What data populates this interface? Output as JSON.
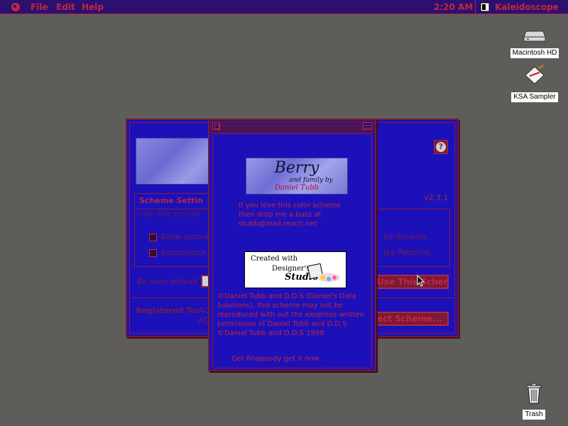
{
  "menubar": {
    "menus": [
      "File",
      "Edit",
      "Help"
    ],
    "clock": "2:20 AM",
    "app_name": "Kaleidoscope"
  },
  "desktop": {
    "icons": [
      {
        "label": "Macintosh HD",
        "icon": "hard-drive-icon"
      },
      {
        "label": "KSA Sampler",
        "icon": "sampler-document-icon"
      },
      {
        "label": "Trash",
        "icon": "trash-icon"
      }
    ]
  },
  "back_window": {
    "tab_label": "Scheme Settin",
    "version": "v2.3.1",
    "group_title": "Use This scheme",
    "options": [
      "Allow auto-s",
      "Automatica",
      "lor Scheme",
      "lay Patterns"
    ],
    "popup_label": "Be uses default",
    "buttons": [
      "Use This Scheme",
      "ect Scheme..."
    ],
    "registered_label": "Registered To:",
    "registered_values": [
      "AC",
      "AC"
    ]
  },
  "about_window": {
    "logo_title": "Berry",
    "logo_subtitle": "and family by",
    "logo_author": "Daniel Tubb",
    "intro": "If you love this color scheme\nthen drop me a buss at\nstubb@mail.reach.net",
    "ds_logo_line1": "Created with",
    "ds_logo_line2": "Designer's",
    "ds_logo_line3": "Studio",
    "copyright": "©Daniel Tubb and D.D.S (Daniel's Data\nSolutions), this scheme may not be\nreproduced with out the exopress written\npermission of Daniel Tubb and D.D.S\n©Daniel Tubb and D.D.S 1998",
    "footer": "Get Rhapsody get it now."
  },
  "colors": {
    "desktop": "#5f5d5a",
    "menubar": "#2b1070",
    "window": "#1c10b8",
    "accent": "#c0283e"
  }
}
